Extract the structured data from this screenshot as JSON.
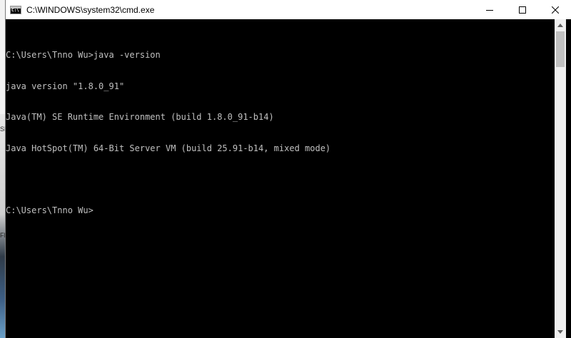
{
  "window": {
    "title": "C:\\WINDOWS\\system32\\cmd.exe",
    "icon": "cmd-icon"
  },
  "caption_buttons": {
    "minimize_icon": "minimize-icon",
    "maximize_icon": "maximize-icon",
    "close_icon": "close-icon"
  },
  "console": {
    "lines": [
      "C:\\Users\\Tnno Wu>java -version",
      "java version \"1.8.0_91\"",
      "Java(TM) SE Runtime Environment (build 1.8.0_91-b14)",
      "Java HotSpot(TM) 64-Bit Server VM (build 25.91-b14, mixed mode)",
      "",
      "C:\\Users\\Tnno Wu>"
    ],
    "text_color": "#c0c0c0",
    "background_color": "#000000"
  },
  "desktop_fragments": [
    "SN",
    "FN"
  ]
}
